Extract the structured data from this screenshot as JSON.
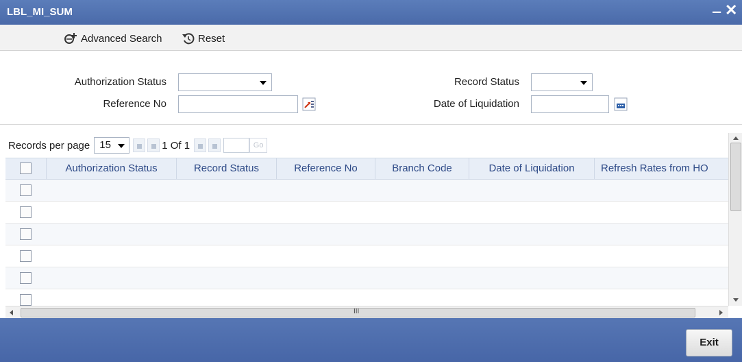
{
  "window": {
    "title": "LBL_MI_SUM",
    "minimize_glyph": "‒",
    "close_glyph": "✕"
  },
  "toolbar": {
    "advanced_search_label": "Advanced Search",
    "reset_label": "Reset"
  },
  "filters": {
    "authorization_status_label": "Authorization Status",
    "authorization_status_value": "",
    "record_status_label": "Record Status",
    "record_status_value": "",
    "reference_no_label": "Reference No",
    "reference_no_value": "",
    "date_of_liquidation_label": "Date of Liquidation",
    "date_of_liquidation_value": ""
  },
  "pager": {
    "records_per_page_label": "Records per page",
    "records_per_page_value": "15",
    "page_info": "1 Of 1",
    "go_label": "Go"
  },
  "grid": {
    "columns": [
      "Authorization Status",
      "Record Status",
      "Reference No",
      "Branch Code",
      "Date of Liquidation",
      "Refresh Rates from HO"
    ]
  },
  "hscroll_center_glyph": "III",
  "footer": {
    "exit_label": "Exit"
  },
  "icons": {
    "advanced_search": "advanced-search-icon",
    "reset": "reset-icon",
    "reference_lookup": "lookup-icon",
    "calendar": "calendar-icon"
  },
  "colors": {
    "titlebar": "#4a6aa9",
    "footer": "#4766a7",
    "header_text": "#2e4a87"
  }
}
